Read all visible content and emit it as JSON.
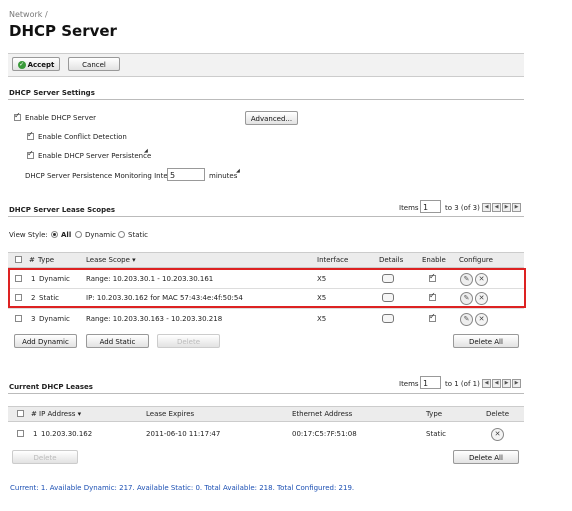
{
  "breadcrumb": "Network /",
  "title": "DHCP Server",
  "toolbar": {
    "accept": "Accept",
    "cancel": "Cancel"
  },
  "settings": {
    "heading": "DHCP Server Settings",
    "enable": "Enable DHCP Server",
    "advanced": "Advanced...",
    "conflict": "Enable Conflict Detection",
    "persistence": "Enable DHCP Server Persistence",
    "interval_label": "DHCP Server Persistence Monitoring Interval:",
    "interval_value": "5",
    "interval_unit": "minutes"
  },
  "scopes": {
    "heading": "DHCP Server Lease Scopes",
    "items_label": "Items",
    "items_value": "1",
    "items_range": "to 3 (of 3)",
    "view_style": "View Style:",
    "view_all": "All",
    "view_dynamic": "Dynamic",
    "view_static": "Static",
    "columns": {
      "num": "#",
      "type": "Type",
      "scope": "Lease Scope",
      "interface": "Interface",
      "details": "Details",
      "enable": "Enable",
      "configure": "Configure"
    },
    "rows": [
      {
        "num": "1",
        "type": "Dynamic",
        "scope": "Range: 10.203.30.1 - 10.203.30.161",
        "iface": "X5"
      },
      {
        "num": "2",
        "type": "Static",
        "scope": "IP: 10.203.30.162 for MAC 57:43:4e:4f:50:54",
        "iface": "X5"
      },
      {
        "num": "3",
        "type": "Dynamic",
        "scope": "Range: 10.203.30.163 - 10.203.30.218",
        "iface": "X5"
      }
    ],
    "btn_add_dynamic": "Add Dynamic",
    "btn_add_static": "Add Static",
    "btn_delete": "Delete",
    "btn_delete_all": "Delete All"
  },
  "leases": {
    "heading": "Current DHCP Leases",
    "items_label": "Items",
    "items_value": "1",
    "items_range": "to 1 (of 1)",
    "columns": {
      "num": "#",
      "ip": "IP Address",
      "expires": "Lease Expires",
      "mac": "Ethernet Address",
      "type": "Type",
      "delete": "Delete"
    },
    "rows": [
      {
        "num": "1",
        "ip": "10.203.30.162",
        "expires": "2011-06-10 11:17:47",
        "mac": "00:17:C5:7F:51:08",
        "type": "Static"
      }
    ],
    "btn_delete": "Delete",
    "btn_delete_all": "Delete All"
  },
  "status": "Current: 1. Available Dynamic: 217. Available Static: 0. Total Available: 218. Total Configured: 219."
}
